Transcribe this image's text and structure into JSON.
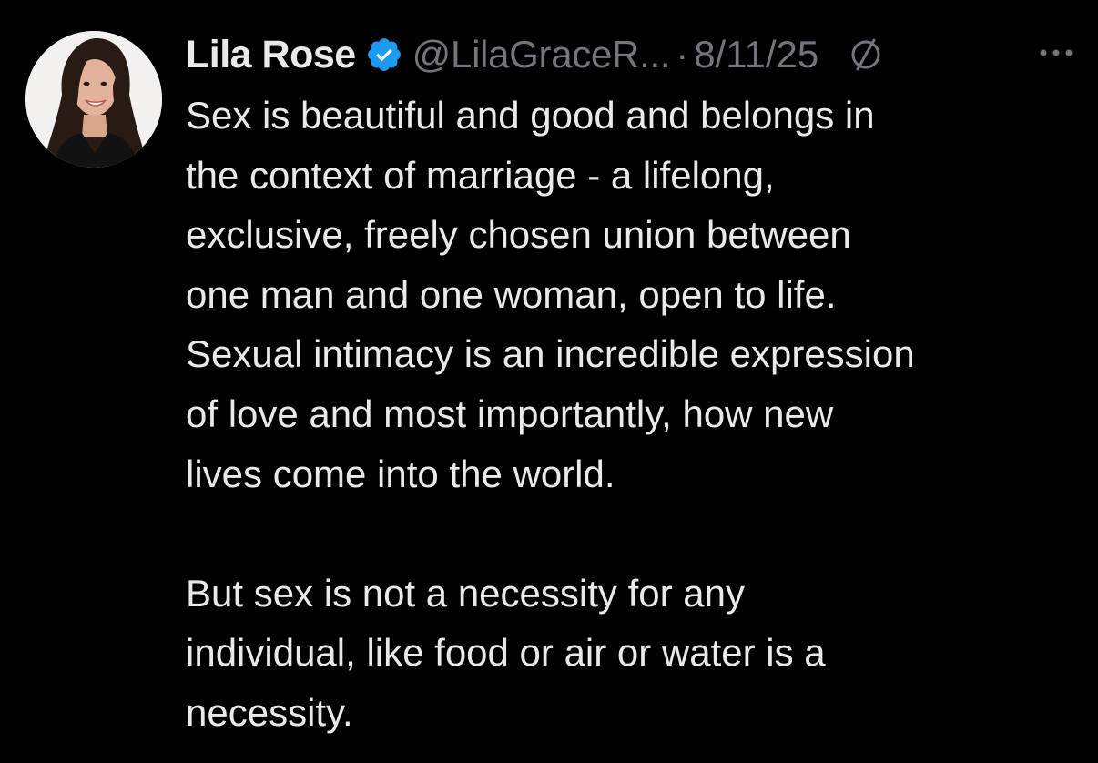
{
  "tweet": {
    "author": {
      "display_name": "Lila Rose",
      "handle": "@LilaGraceR...",
      "verified": true,
      "avatar_icon": "profile-photo"
    },
    "separator": "·",
    "date": "8/11/25",
    "edited_icon": "edit-indicator-icon",
    "more_icon": "more-options-icon",
    "paragraphs": [
      {
        "lines": [
          "Sex is beautiful and good and belongs in",
          "the context of marriage - a lifelong,",
          "exclusive, freely chosen union between",
          "one man and one woman, open to life.",
          "Sexual intimacy is an incredible expression",
          "of love and most importantly, how new",
          "lives come into the world."
        ]
      },
      {
        "lines": [
          "But sex is not a necessity for any",
          "individual, like food or air or water is a",
          "necessity."
        ]
      }
    ],
    "colors": {
      "background": "#000000",
      "text_primary": "#e7e9ea",
      "text_secondary": "#71767b",
      "verified_badge": "#1d9bf0"
    }
  }
}
